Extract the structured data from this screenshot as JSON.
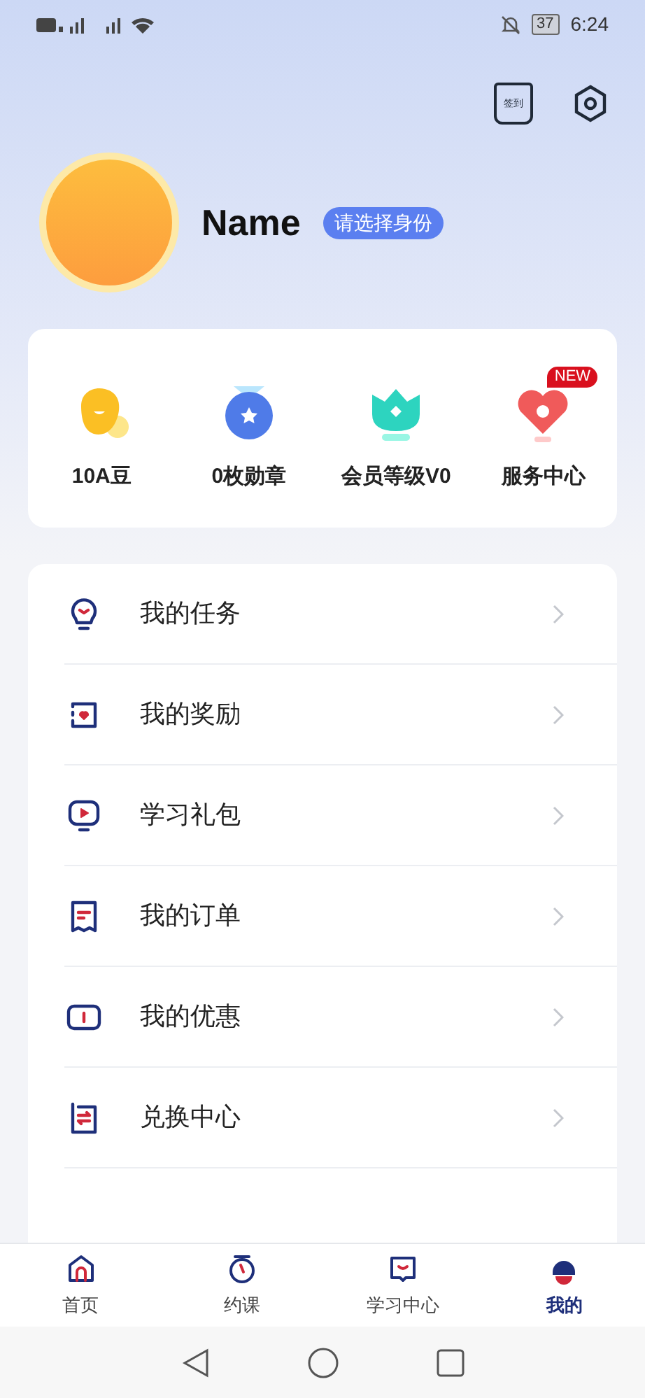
{
  "status_bar": {
    "time": "6:24",
    "battery": "37"
  },
  "header": {
    "checkin_label": "签到"
  },
  "profile": {
    "name": "Name",
    "identity_badge": "请选择身份"
  },
  "stats": [
    {
      "kind": "bean",
      "label": "10A豆"
    },
    {
      "kind": "medal",
      "label": "0枚勋章"
    },
    {
      "kind": "crown",
      "label": "会员等级V0"
    },
    {
      "kind": "heart",
      "label": "服务中心",
      "badge": "NEW"
    }
  ],
  "menu": [
    {
      "kind": "task",
      "label": "我的任务"
    },
    {
      "kind": "reward",
      "label": "我的奖励"
    },
    {
      "kind": "video",
      "label": "学习礼包"
    },
    {
      "kind": "order",
      "label": "我的订单"
    },
    {
      "kind": "coupon",
      "label": "我的优惠"
    },
    {
      "kind": "exchange",
      "label": "兑换中心"
    }
  ],
  "tab_bar": [
    {
      "kind": "home",
      "label": "首页",
      "selected": false
    },
    {
      "kind": "clock",
      "label": "约课",
      "selected": false
    },
    {
      "kind": "study",
      "label": "学习中心",
      "selected": false
    },
    {
      "kind": "me",
      "label": "我的",
      "selected": true
    }
  ]
}
